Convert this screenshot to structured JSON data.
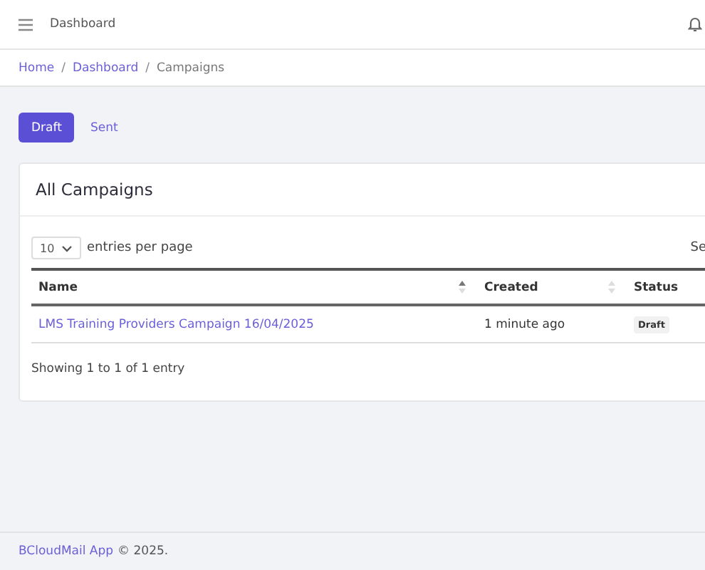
{
  "header": {
    "title": "Dashboard"
  },
  "breadcrumb_separator": "/",
  "breadcrumb": [
    {
      "label": "Home",
      "link": true
    },
    {
      "label": "Dashboard",
      "link": true
    },
    {
      "label": "Campaigns",
      "link": false
    }
  ],
  "tabs": [
    {
      "label": "Draft",
      "selected": true
    },
    {
      "label": "Sent",
      "selected": false
    }
  ],
  "card": {
    "title": "All Campaigns",
    "per_page": {
      "value": "10",
      "label": "entries per page"
    },
    "search_label": "Se",
    "table": {
      "columns": [
        {
          "label": "Name",
          "sorted": true
        },
        {
          "label": "Created",
          "sorted": false
        },
        {
          "label": "Status"
        }
      ],
      "rows": [
        {
          "name": "LMS Training Providers Campaign 16/04/2025",
          "created": "1 minute ago",
          "status": "Draft"
        }
      ]
    },
    "info": "Showing 1 to 1 of 1 entry"
  },
  "footer": {
    "brand": "BCloudMail App",
    "text": "© 2025."
  }
}
